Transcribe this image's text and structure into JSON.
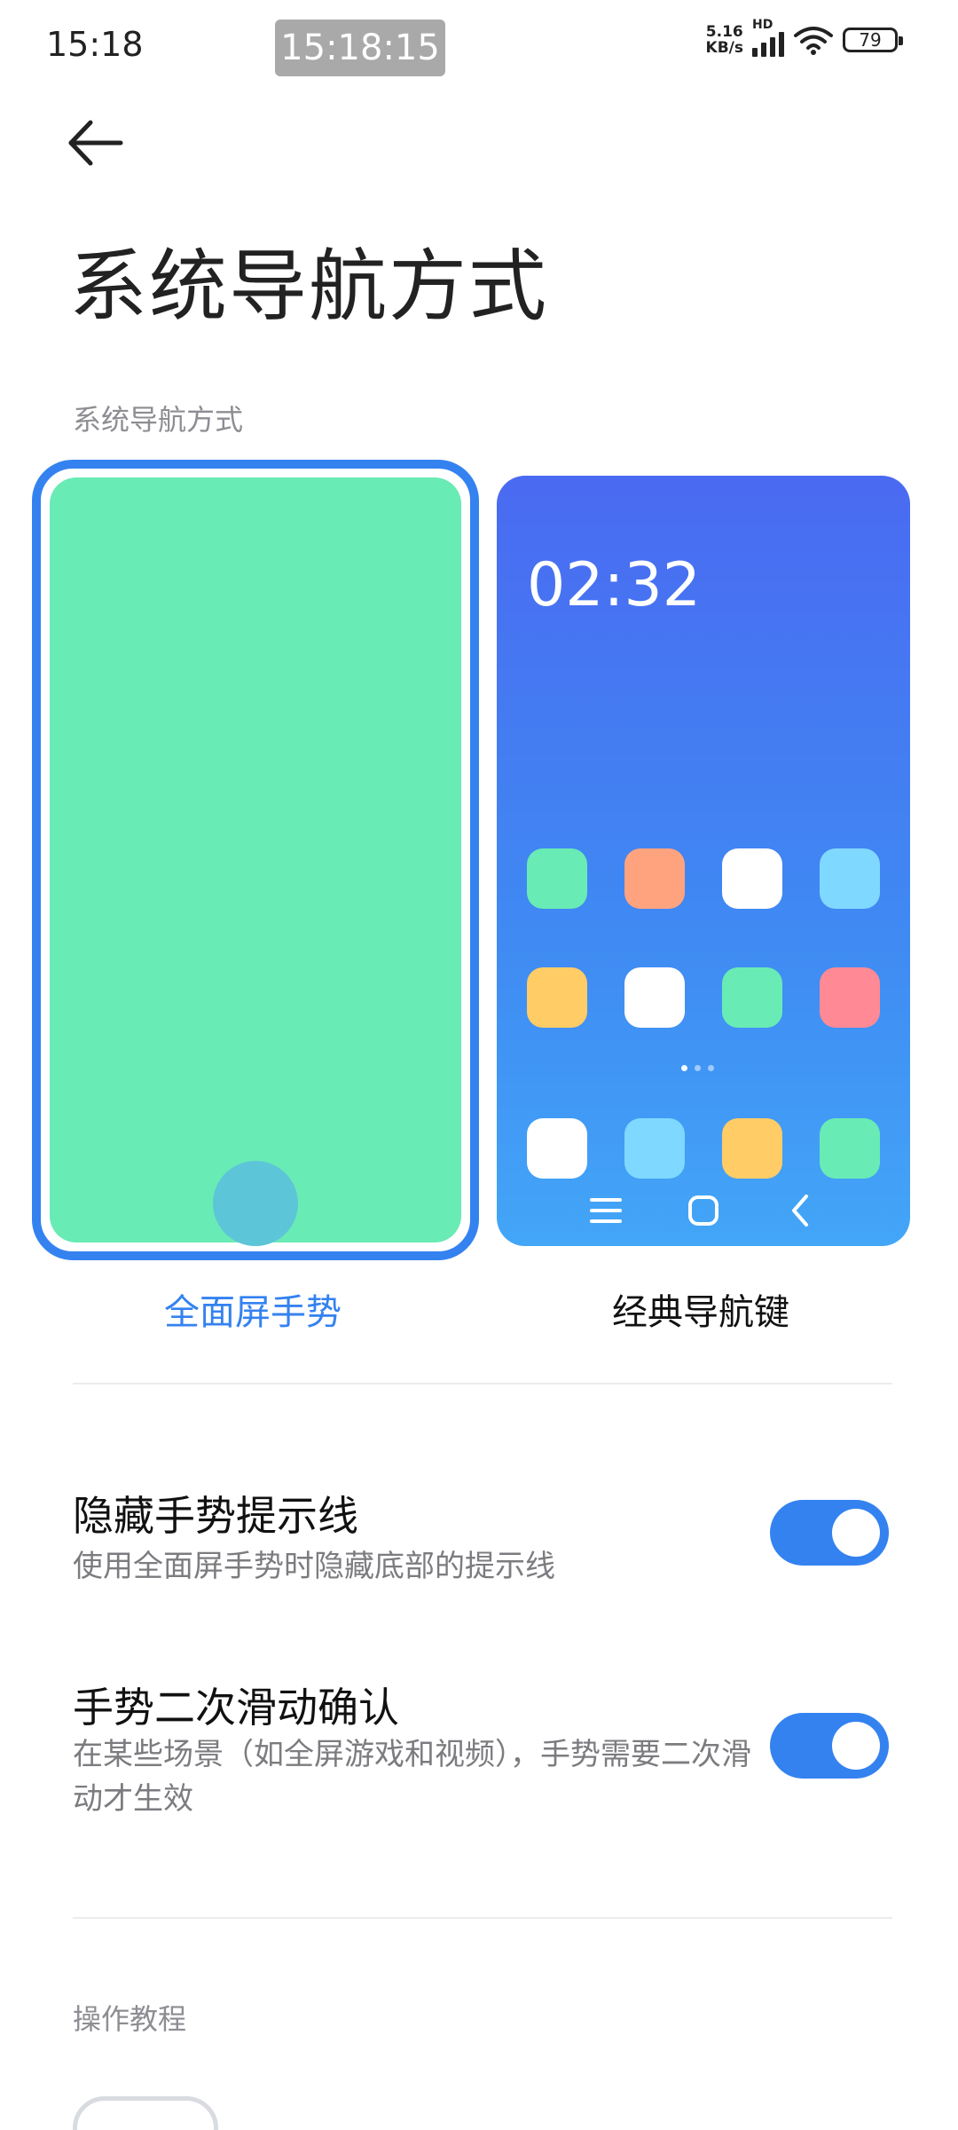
{
  "status_bar": {
    "time": "15:18",
    "clock_pill": "15:18:15",
    "net_speed_value": "5.16",
    "net_speed_unit": "KB/s",
    "hd_label": "HD",
    "battery_level": "79",
    "icons": [
      "signal-icon",
      "wifi-icon",
      "battery-icon"
    ]
  },
  "header": {
    "back_icon": "arrow-left-icon",
    "title": "系统导航方式"
  },
  "navigation_section": {
    "label": "系统导航方式",
    "options": [
      {
        "label": "全面屏手势",
        "selected": true
      },
      {
        "label": "经典导航键",
        "selected": false
      }
    ],
    "classic_preview": {
      "time": "02:32",
      "app_colors": [
        [
          "#69ebb5",
          "#ffa37f",
          "#ffffff",
          "#7fd8ff"
        ],
        [
          "#ffcc66",
          "#ffffff",
          "#69ebb5",
          "#ff8a95"
        ],
        [
          "#ffffff",
          "#7fd8ff",
          "#ffcc66",
          "#69ebb5"
        ]
      ],
      "nav_keys": [
        "menu-icon",
        "home-icon",
        "back-icon"
      ]
    }
  },
  "settings": [
    {
      "title": "隐藏手势提示线",
      "subtitle": "使用全面屏手势时隐藏底部的提示线",
      "enabled": true
    },
    {
      "title": "手势二次滑动确认",
      "subtitle": "在某些场景（如全屏游戏和视频），手势需要二次滑动才生效",
      "enabled": true
    }
  ],
  "tutorial_section": {
    "label": "操作教程"
  },
  "colors": {
    "accent": "#3482f0",
    "gesture_preview": "#69ebb5",
    "secondary_text": "#7c7c80"
  }
}
